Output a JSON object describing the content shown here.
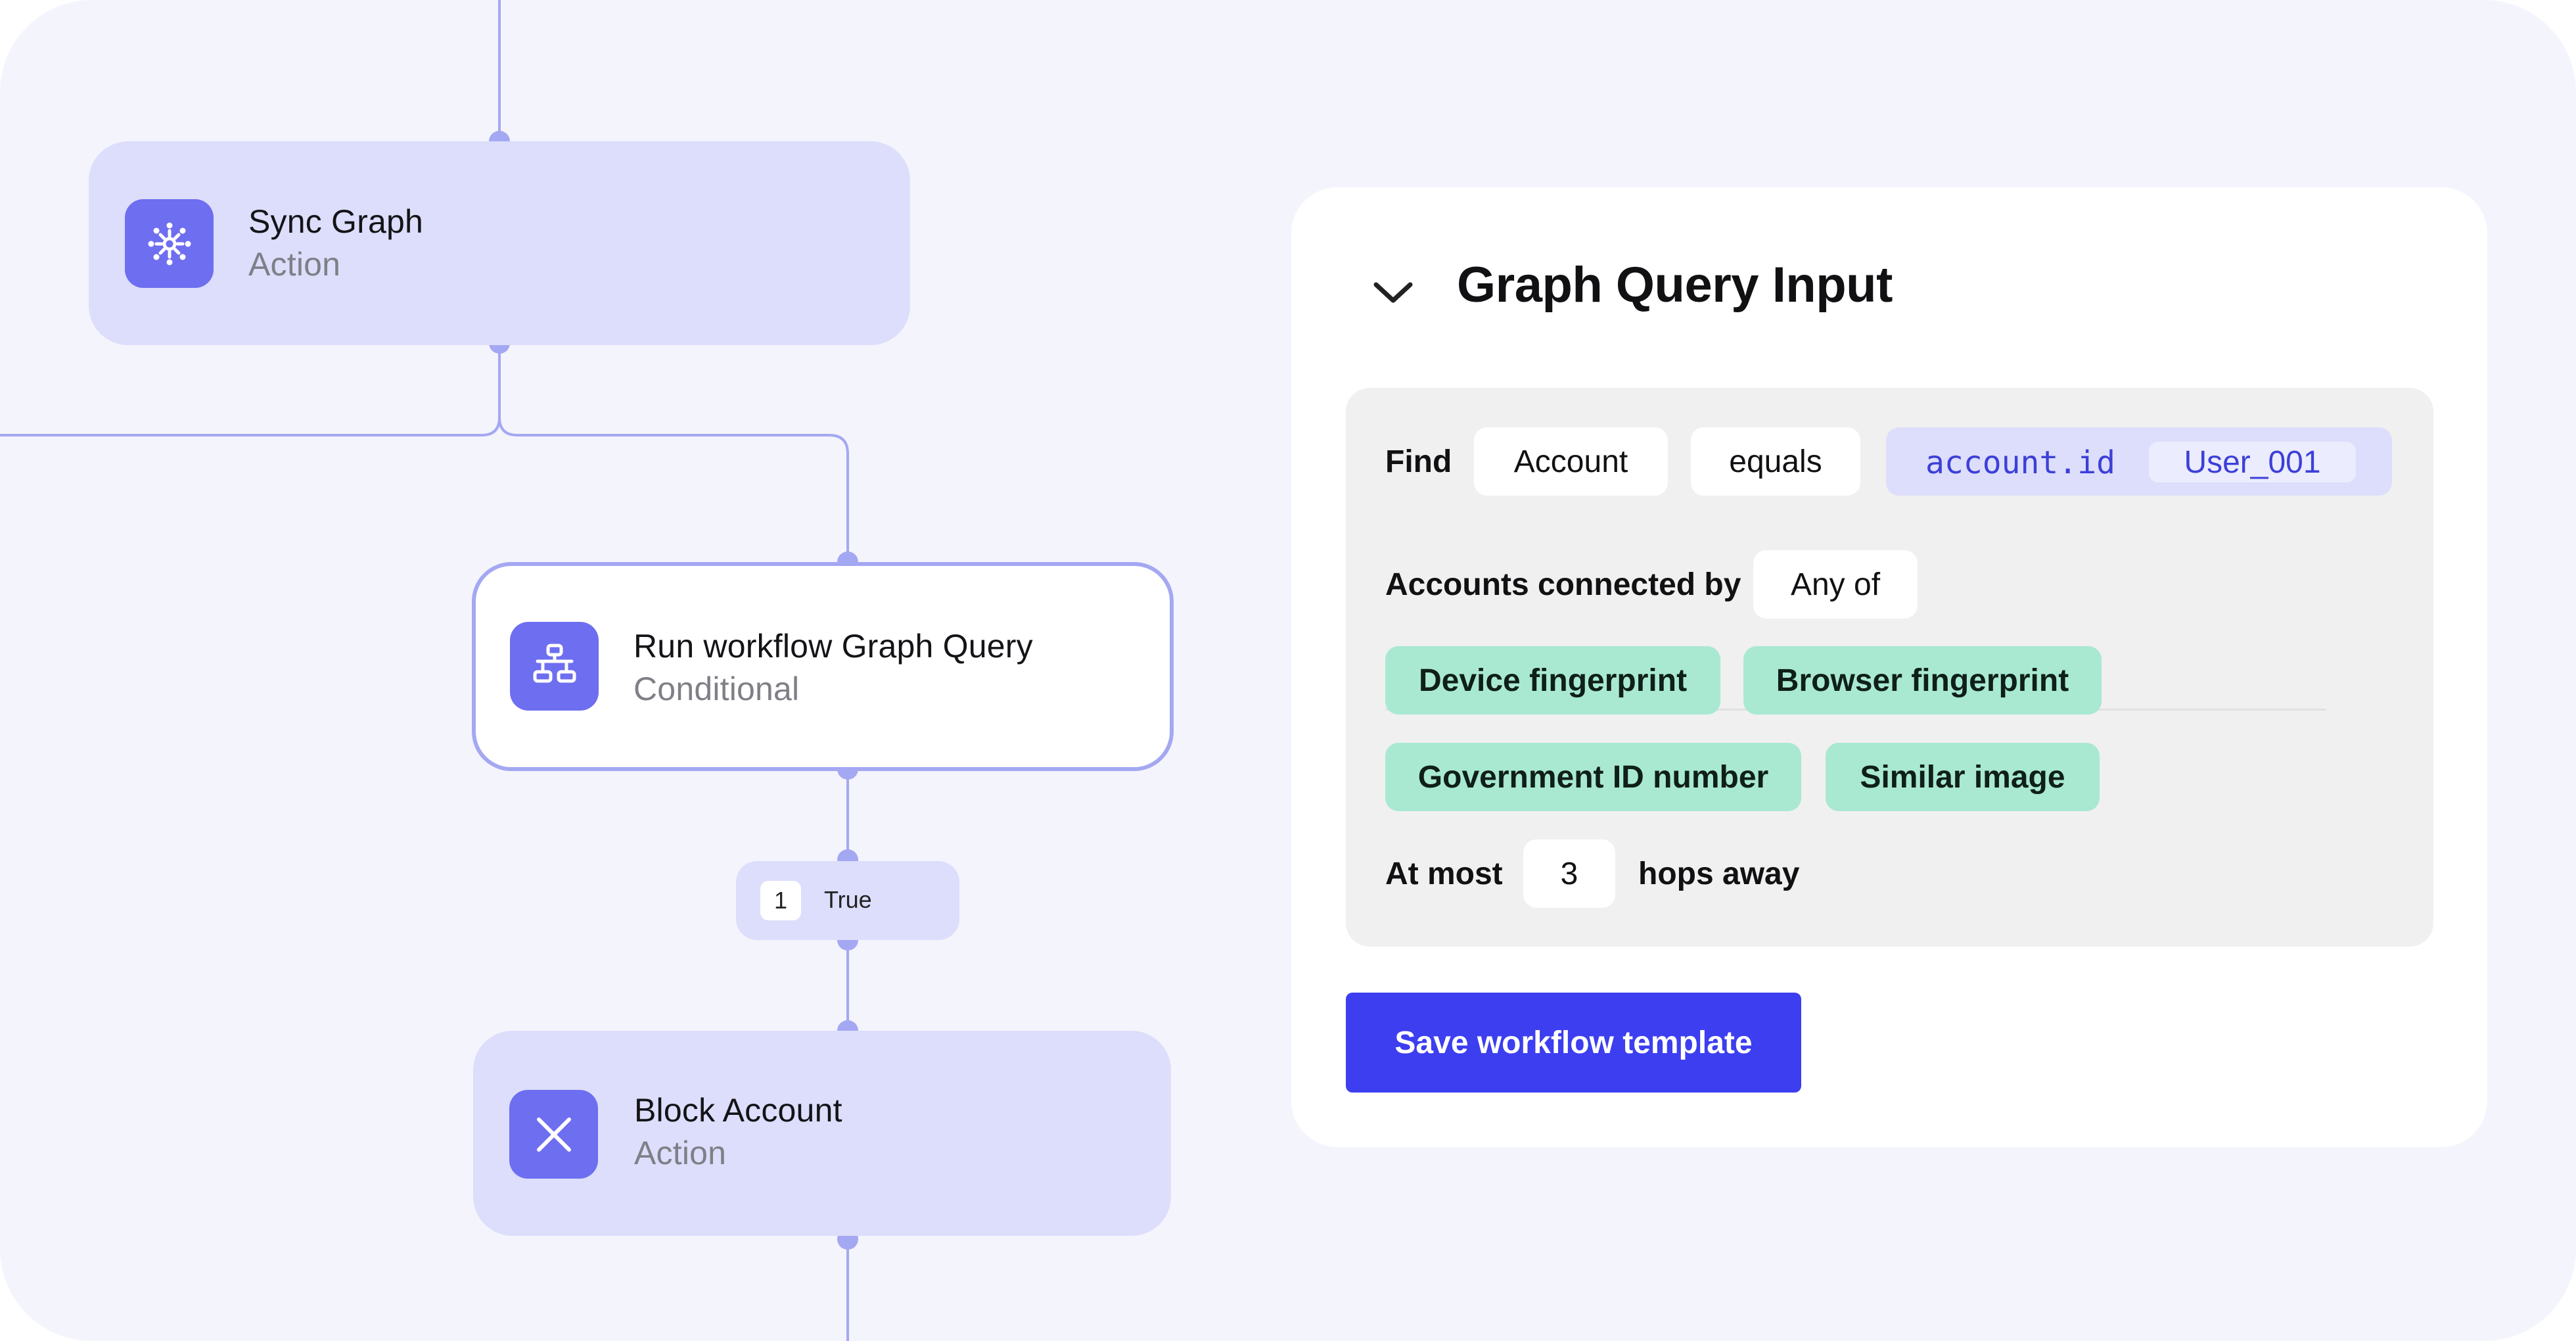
{
  "workflow": {
    "sync_node": {
      "title": "Sync Graph",
      "subtitle": "Action",
      "icon": "network-icon"
    },
    "query_node": {
      "title": "Run workflow Graph Query",
      "subtitle": "Conditional",
      "icon": "flowchart-icon"
    },
    "branch": {
      "number": "1",
      "label": "True"
    },
    "block_node": {
      "title": "Block Account",
      "subtitle": "Action",
      "icon": "close-icon"
    }
  },
  "panel": {
    "title": "Graph Query Input",
    "collapse_icon": "chevron-down-icon",
    "find": {
      "label": "Find",
      "entity": "Account",
      "operator": "equals",
      "field": "account.id",
      "value": "User_001"
    },
    "connected": {
      "label": "Accounts connected by",
      "mode": "Any of",
      "tags": [
        "Device fingerprint",
        "Browser fingerprint",
        "Government ID number",
        "Similar image"
      ]
    },
    "hops": {
      "prefix": "At most",
      "value": "3",
      "suffix": "hops away"
    },
    "save_label": "Save workflow template"
  },
  "colors": {
    "background": "#f4f4fd",
    "node_fill": "#dcdefb",
    "accent": "#6e6ef0",
    "connector": "#a4a8f2",
    "tag_fill": "#a9e9d1",
    "button": "#3c3ef0",
    "code_text": "#3d3fd8"
  }
}
